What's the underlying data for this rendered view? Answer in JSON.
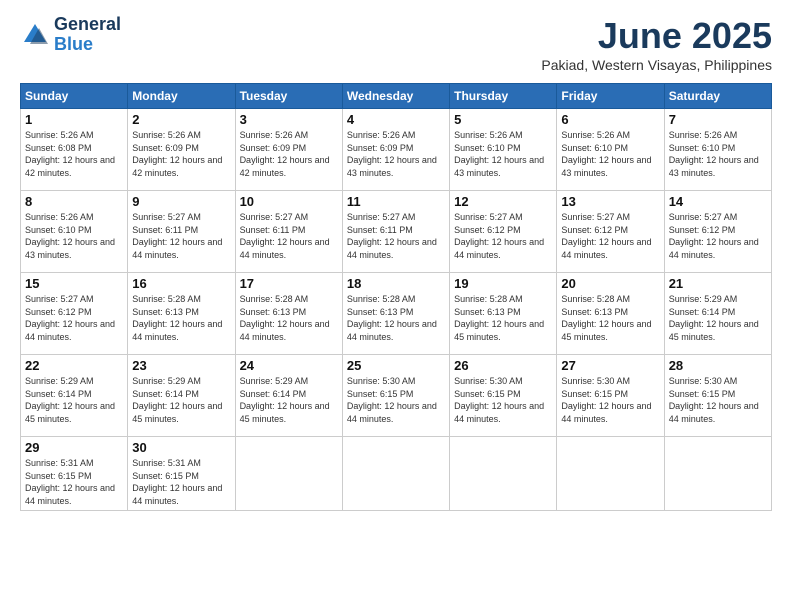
{
  "logo": {
    "line1": "General",
    "line2": "Blue"
  },
  "title": "June 2025",
  "subtitle": "Pakiad, Western Visayas, Philippines",
  "weekdays": [
    "Sunday",
    "Monday",
    "Tuesday",
    "Wednesday",
    "Thursday",
    "Friday",
    "Saturday"
  ],
  "weeks": [
    [
      {
        "day": "1",
        "sunrise": "5:26 AM",
        "sunset": "6:08 PM",
        "daylight": "12 hours and 42 minutes."
      },
      {
        "day": "2",
        "sunrise": "5:26 AM",
        "sunset": "6:09 PM",
        "daylight": "12 hours and 42 minutes."
      },
      {
        "day": "3",
        "sunrise": "5:26 AM",
        "sunset": "6:09 PM",
        "daylight": "12 hours and 42 minutes."
      },
      {
        "day": "4",
        "sunrise": "5:26 AM",
        "sunset": "6:09 PM",
        "daylight": "12 hours and 43 minutes."
      },
      {
        "day": "5",
        "sunrise": "5:26 AM",
        "sunset": "6:10 PM",
        "daylight": "12 hours and 43 minutes."
      },
      {
        "day": "6",
        "sunrise": "5:26 AM",
        "sunset": "6:10 PM",
        "daylight": "12 hours and 43 minutes."
      },
      {
        "day": "7",
        "sunrise": "5:26 AM",
        "sunset": "6:10 PM",
        "daylight": "12 hours and 43 minutes."
      }
    ],
    [
      {
        "day": "8",
        "sunrise": "5:26 AM",
        "sunset": "6:10 PM",
        "daylight": "12 hours and 43 minutes."
      },
      {
        "day": "9",
        "sunrise": "5:27 AM",
        "sunset": "6:11 PM",
        "daylight": "12 hours and 44 minutes."
      },
      {
        "day": "10",
        "sunrise": "5:27 AM",
        "sunset": "6:11 PM",
        "daylight": "12 hours and 44 minutes."
      },
      {
        "day": "11",
        "sunrise": "5:27 AM",
        "sunset": "6:11 PM",
        "daylight": "12 hours and 44 minutes."
      },
      {
        "day": "12",
        "sunrise": "5:27 AM",
        "sunset": "6:12 PM",
        "daylight": "12 hours and 44 minutes."
      },
      {
        "day": "13",
        "sunrise": "5:27 AM",
        "sunset": "6:12 PM",
        "daylight": "12 hours and 44 minutes."
      },
      {
        "day": "14",
        "sunrise": "5:27 AM",
        "sunset": "6:12 PM",
        "daylight": "12 hours and 44 minutes."
      }
    ],
    [
      {
        "day": "15",
        "sunrise": "5:27 AM",
        "sunset": "6:12 PM",
        "daylight": "12 hours and 44 minutes."
      },
      {
        "day": "16",
        "sunrise": "5:28 AM",
        "sunset": "6:13 PM",
        "daylight": "12 hours and 44 minutes."
      },
      {
        "day": "17",
        "sunrise": "5:28 AM",
        "sunset": "6:13 PM",
        "daylight": "12 hours and 44 minutes."
      },
      {
        "day": "18",
        "sunrise": "5:28 AM",
        "sunset": "6:13 PM",
        "daylight": "12 hours and 44 minutes."
      },
      {
        "day": "19",
        "sunrise": "5:28 AM",
        "sunset": "6:13 PM",
        "daylight": "12 hours and 45 minutes."
      },
      {
        "day": "20",
        "sunrise": "5:28 AM",
        "sunset": "6:13 PM",
        "daylight": "12 hours and 45 minutes."
      },
      {
        "day": "21",
        "sunrise": "5:29 AM",
        "sunset": "6:14 PM",
        "daylight": "12 hours and 45 minutes."
      }
    ],
    [
      {
        "day": "22",
        "sunrise": "5:29 AM",
        "sunset": "6:14 PM",
        "daylight": "12 hours and 45 minutes."
      },
      {
        "day": "23",
        "sunrise": "5:29 AM",
        "sunset": "6:14 PM",
        "daylight": "12 hours and 45 minutes."
      },
      {
        "day": "24",
        "sunrise": "5:29 AM",
        "sunset": "6:14 PM",
        "daylight": "12 hours and 45 minutes."
      },
      {
        "day": "25",
        "sunrise": "5:30 AM",
        "sunset": "6:15 PM",
        "daylight": "12 hours and 44 minutes."
      },
      {
        "day": "26",
        "sunrise": "5:30 AM",
        "sunset": "6:15 PM",
        "daylight": "12 hours and 44 minutes."
      },
      {
        "day": "27",
        "sunrise": "5:30 AM",
        "sunset": "6:15 PM",
        "daylight": "12 hours and 44 minutes."
      },
      {
        "day": "28",
        "sunrise": "5:30 AM",
        "sunset": "6:15 PM",
        "daylight": "12 hours and 44 minutes."
      }
    ],
    [
      {
        "day": "29",
        "sunrise": "5:31 AM",
        "sunset": "6:15 PM",
        "daylight": "12 hours and 44 minutes."
      },
      {
        "day": "30",
        "sunrise": "5:31 AM",
        "sunset": "6:15 PM",
        "daylight": "12 hours and 44 minutes."
      },
      null,
      null,
      null,
      null,
      null
    ]
  ],
  "labels": {
    "sunrise_prefix": "Sunrise: ",
    "sunset_prefix": "Sunset: ",
    "daylight_prefix": "Daylight: "
  }
}
